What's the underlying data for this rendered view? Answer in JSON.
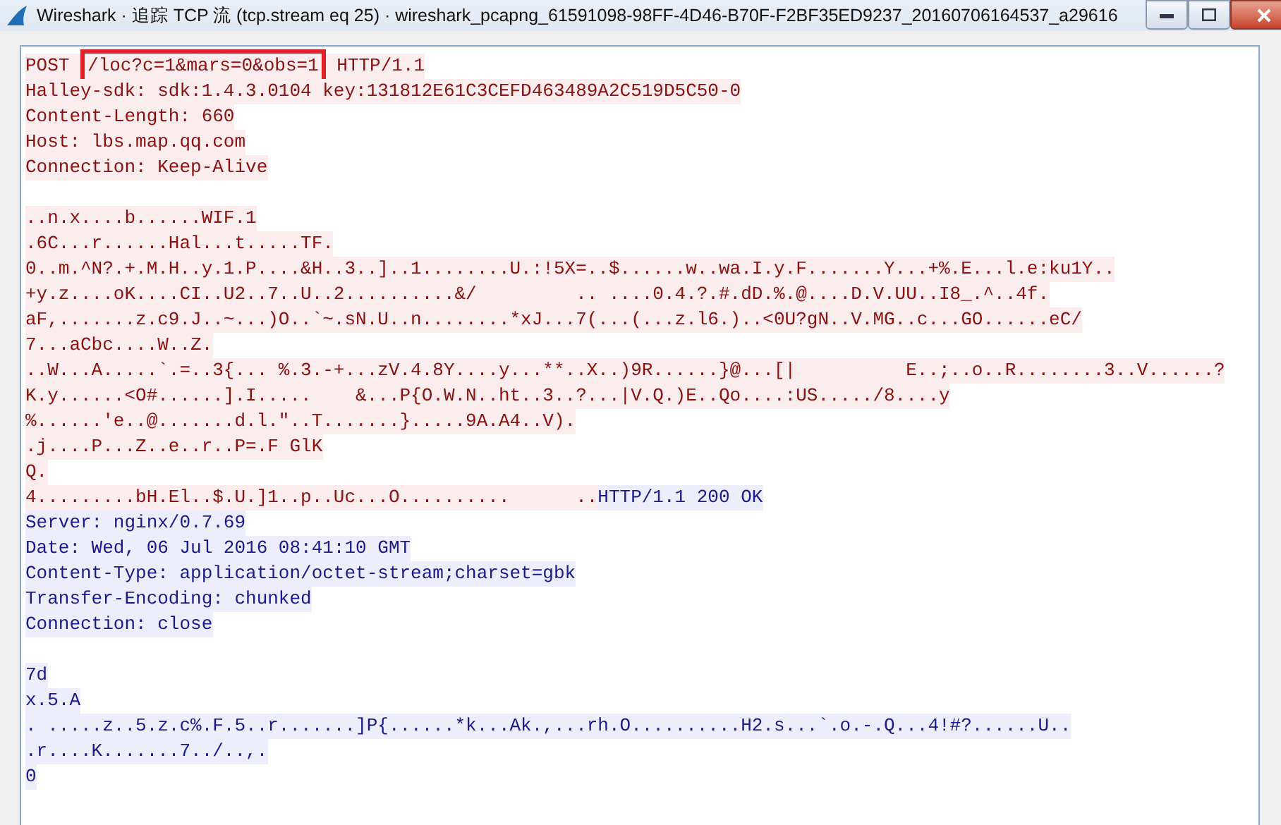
{
  "window": {
    "title": "Wireshark · 追踪 TCP 流 (tcp.stream eq 25) · wireshark_pcapng_61591098-98FF-4D46-B70F-F2BF35ED9237_20160706164537_a29616"
  },
  "lines": [
    {
      "kind": "text",
      "segments": [
        {
          "kind": "client",
          "text": "POST ",
          "highlighted": false
        },
        {
          "kind": "client",
          "text": "/loc?c=1&mars=0&obs=1",
          "highlighted": true
        },
        {
          "kind": "client",
          "text": " HTTP/1.1",
          "highlighted": false
        }
      ]
    },
    {
      "kind": "text",
      "segments": [
        {
          "kind": "client",
          "text": "Halley-sdk: sdk:1.4.3.0104 key:131812E61C3CEFD463489A2C519D5C50-0",
          "highlighted": false
        }
      ]
    },
    {
      "kind": "text",
      "segments": [
        {
          "kind": "client",
          "text": "Content-Length: 660",
          "highlighted": false
        }
      ]
    },
    {
      "kind": "text",
      "segments": [
        {
          "kind": "client",
          "text": "Host: lbs.map.qq.com",
          "highlighted": false
        }
      ]
    },
    {
      "kind": "text",
      "segments": [
        {
          "kind": "client",
          "text": "Connection: Keep-Alive",
          "highlighted": false
        }
      ]
    },
    {
      "kind": "blank"
    },
    {
      "kind": "text",
      "segments": [
        {
          "kind": "client",
          "text": "..n.x....b......WIF.1",
          "highlighted": false
        }
      ]
    },
    {
      "kind": "text",
      "segments": [
        {
          "kind": "client",
          "text": ".6C...r......Hal...t.....TF.",
          "highlighted": false
        }
      ]
    },
    {
      "kind": "text",
      "segments": [
        {
          "kind": "client",
          "text": "0..m.^N?.+.M.H..y.1.P....&H..3..]..1........U.:!5X=..$......w..wa.I.y.F.......Y...+%.E...l.e:ku1Y..",
          "highlighted": false
        }
      ]
    },
    {
      "kind": "text",
      "segments": [
        {
          "kind": "client",
          "text": "+y.z....oK....CI..U2..7..U..2..........&/         .. ....0.4.?.#.dD.%.@....D.V.UU..I8_.^..4f.",
          "highlighted": false
        }
      ]
    },
    {
      "kind": "text",
      "segments": [
        {
          "kind": "client",
          "text": "aF,.......z.c9.J..~...)O..`~.sN.U..n........*xJ...7(...(...z.l6.)..<0U?gN..V.MG..c...GO......eC/",
          "highlighted": false
        }
      ]
    },
    {
      "kind": "text",
      "segments": [
        {
          "kind": "client",
          "text": "7...aCbc....W..Z.",
          "highlighted": false
        }
      ]
    },
    {
      "kind": "text",
      "segments": [
        {
          "kind": "client",
          "text": "..W...A.....`.=..3{... %.3.-+...zV.4.8Y....y...**..X..)9R......}@...[|          E..;..o..R........3..V......?",
          "highlighted": false
        }
      ]
    },
    {
      "kind": "text",
      "segments": [
        {
          "kind": "client",
          "text": "K.y......<O#......].I.....    &...P{O.W.N..ht..3..?...|V.Q.)E..Qo....:US...../8....y",
          "highlighted": false
        }
      ]
    },
    {
      "kind": "text",
      "segments": [
        {
          "kind": "client",
          "text": "%......'e..@.......d.l.\"..T.......}.....9A.A4..V).",
          "highlighted": false
        }
      ]
    },
    {
      "kind": "text",
      "segments": [
        {
          "kind": "client",
          "text": ".j....P...Z..e..r..P=.F GlK",
          "highlighted": false
        }
      ]
    },
    {
      "kind": "text",
      "segments": [
        {
          "kind": "client",
          "text": "Q.",
          "highlighted": false
        }
      ]
    },
    {
      "kind": "text",
      "segments": [
        {
          "kind": "client",
          "text": "4.........bH.El..$.U.]1..p..Uc...O..........      ..",
          "highlighted": false
        },
        {
          "kind": "server",
          "text": "HTTP/1.1 200 OK",
          "highlighted": false
        }
      ]
    },
    {
      "kind": "text",
      "segments": [
        {
          "kind": "server",
          "text": "Server: nginx/0.7.69",
          "highlighted": false
        }
      ]
    },
    {
      "kind": "text",
      "segments": [
        {
          "kind": "server",
          "text": "Date: Wed, 06 Jul 2016 08:41:10 GMT",
          "highlighted": false
        }
      ]
    },
    {
      "kind": "text",
      "segments": [
        {
          "kind": "server",
          "text": "Content-Type: application/octet-stream;charset=gbk",
          "highlighted": false
        }
      ]
    },
    {
      "kind": "text",
      "segments": [
        {
          "kind": "server",
          "text": "Transfer-Encoding: chunked",
          "highlighted": false
        }
      ]
    },
    {
      "kind": "text",
      "segments": [
        {
          "kind": "server",
          "text": "Connection: close",
          "highlighted": false
        }
      ]
    },
    {
      "kind": "blank"
    },
    {
      "kind": "text",
      "segments": [
        {
          "kind": "server",
          "text": "7d",
          "highlighted": false
        }
      ]
    },
    {
      "kind": "text",
      "segments": [
        {
          "kind": "server",
          "text": "x.5.A",
          "highlighted": false
        }
      ]
    },
    {
      "kind": "text",
      "segments": [
        {
          "kind": "server",
          "text": ". .....z..5.z.c%.F.5..r.......]P{......*k...Ak.,...rh.O..........H2.s...`.o.-.Q...4!#?......U..",
          "highlighted": false
        }
      ]
    },
    {
      "kind": "text",
      "segments": [
        {
          "kind": "server",
          "text": ".r....K.......7../..,.",
          "highlighted": false
        }
      ]
    },
    {
      "kind": "text",
      "segments": [
        {
          "kind": "server",
          "text": "0",
          "highlighted": false
        }
      ]
    }
  ]
}
